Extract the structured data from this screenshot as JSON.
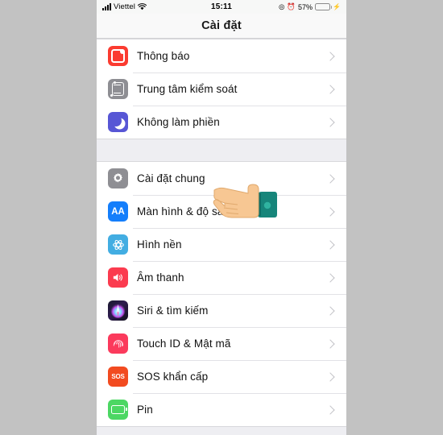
{
  "status_bar": {
    "carrier": "Viettel",
    "time": "15:11",
    "battery_percent": "57%",
    "battery_level": 57,
    "icons": [
      "signal-bars-icon",
      "wifi-icon",
      "do-not-disturb-icon",
      "alarm-icon",
      "battery-icon",
      "charging-bolt-icon"
    ]
  },
  "nav": {
    "title": "Cài đặt"
  },
  "groups": [
    {
      "rows": [
        {
          "label": "Thông báo",
          "icon": "notifications-icon",
          "color": "#fb3b30"
        },
        {
          "label": "Trung tâm kiểm soát",
          "icon": "control-center-icon",
          "color": "#8e8e93"
        },
        {
          "label": "Không làm phiền",
          "icon": "do-not-disturb-moon-icon",
          "color": "#5756d5"
        }
      ]
    },
    {
      "rows": [
        {
          "label": "Cài đặt chung",
          "icon": "gear-icon",
          "color": "#8e8e93"
        },
        {
          "label": "Màn hình & độ sáng",
          "icon": "display-brightness-icon",
          "color": "#147efb",
          "glyph": "AA"
        },
        {
          "label": "Hình nền",
          "icon": "wallpaper-icon",
          "color": "#42ade2"
        },
        {
          "label": "Âm thanh",
          "icon": "sound-speaker-icon",
          "color": "#fb3b4f"
        },
        {
          "label": "Siri & tìm kiếm",
          "icon": "siri-icon",
          "color": "#1a1a2e"
        },
        {
          "label": "Touch ID & Mật mã",
          "icon": "fingerprint-icon",
          "color": "#fb3a5c"
        },
        {
          "label": "SOS khẩn cấp",
          "icon": "sos-icon",
          "color": "#f24b20",
          "glyph": "SOS"
        },
        {
          "label": "Pin",
          "icon": "battery-icon",
          "color": "#4cd763"
        }
      ]
    }
  ],
  "cursor": {
    "type": "pointing-hand-cursor",
    "skin_color": "#f7c793",
    "sleeve_color": "#16857a"
  },
  "colors": {
    "page_background": "#c2c2c2",
    "list_background": "#eeeef2",
    "row_background": "#ffffff",
    "chevron": "#c2c2c7"
  }
}
